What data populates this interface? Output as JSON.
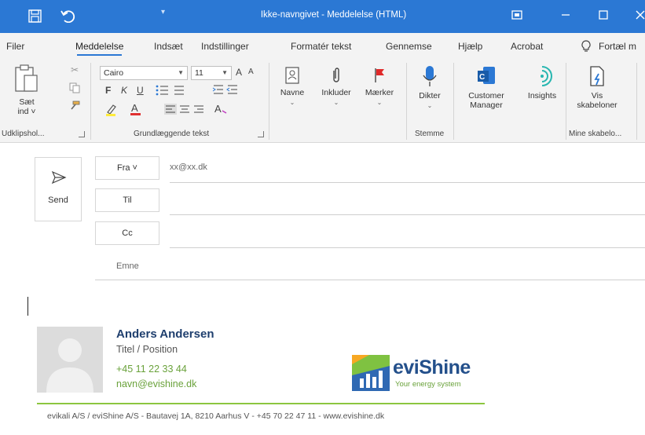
{
  "window": {
    "title": "Ikke-navngivet  -  Meddelelse (HTML)",
    "controls": [
      "ribbon-display-icon",
      "minimize-icon",
      "maximize-icon",
      "close-icon"
    ]
  },
  "tabs": {
    "items": [
      "Filer",
      "Meddelelse",
      "Indsæt",
      "Indstillinger",
      "Formatér tekst",
      "Gennemse",
      "Hjælp",
      "Acrobat",
      "Fortæl m"
    ],
    "active": "Meddelelse"
  },
  "ribbon": {
    "clipboard": {
      "paste_label_1": "Sæt",
      "paste_label_2": "ind ˅",
      "group_label": "Udklipshol..."
    },
    "basic_text": {
      "font": "Cairo",
      "font_size": "11",
      "bold": "F",
      "italic": "K",
      "underline": "U",
      "grow": "A",
      "shrink": "A",
      "group_label": "Grundlæggende tekst"
    },
    "names": {
      "label": "Navne"
    },
    "include": {
      "label": "Inkluder"
    },
    "tags": {
      "label": "Mærker"
    },
    "dictate": {
      "label": "Dikter",
      "group_label": "Stemme"
    },
    "customer_manager": {
      "label_1": "Customer",
      "label_2": "Manager"
    },
    "insights": {
      "label": "Insights"
    },
    "templates": {
      "label_1": "Vis",
      "label_2": "skabeloner",
      "group_label": "Mine skabelo..."
    }
  },
  "compose": {
    "send_label": "Send",
    "from_label": "Fra ˅",
    "from_value": "xx@xx.dk",
    "to_label": "Til",
    "cc_label": "Cc",
    "subject_label": "Emne"
  },
  "signature": {
    "name": "Anders Andersen",
    "title": "Titel / Position",
    "phone": "+45 11 22 33 44",
    "email": "navn@evishine.dk",
    "logo_brand": "eviShine",
    "logo_tagline": "Your energy system",
    "footer": "evikali A/S / eviShine A/S - Bautavej 1A, 8210 Aarhus V - +45 70 22 47 11 - www.evishine.dk",
    "accent_color": "#8cc63f",
    "name_color": "#1f3f6e"
  },
  "colors": {
    "titlebar": "#2b78d4",
    "ribbon": "#f3f3f3"
  }
}
